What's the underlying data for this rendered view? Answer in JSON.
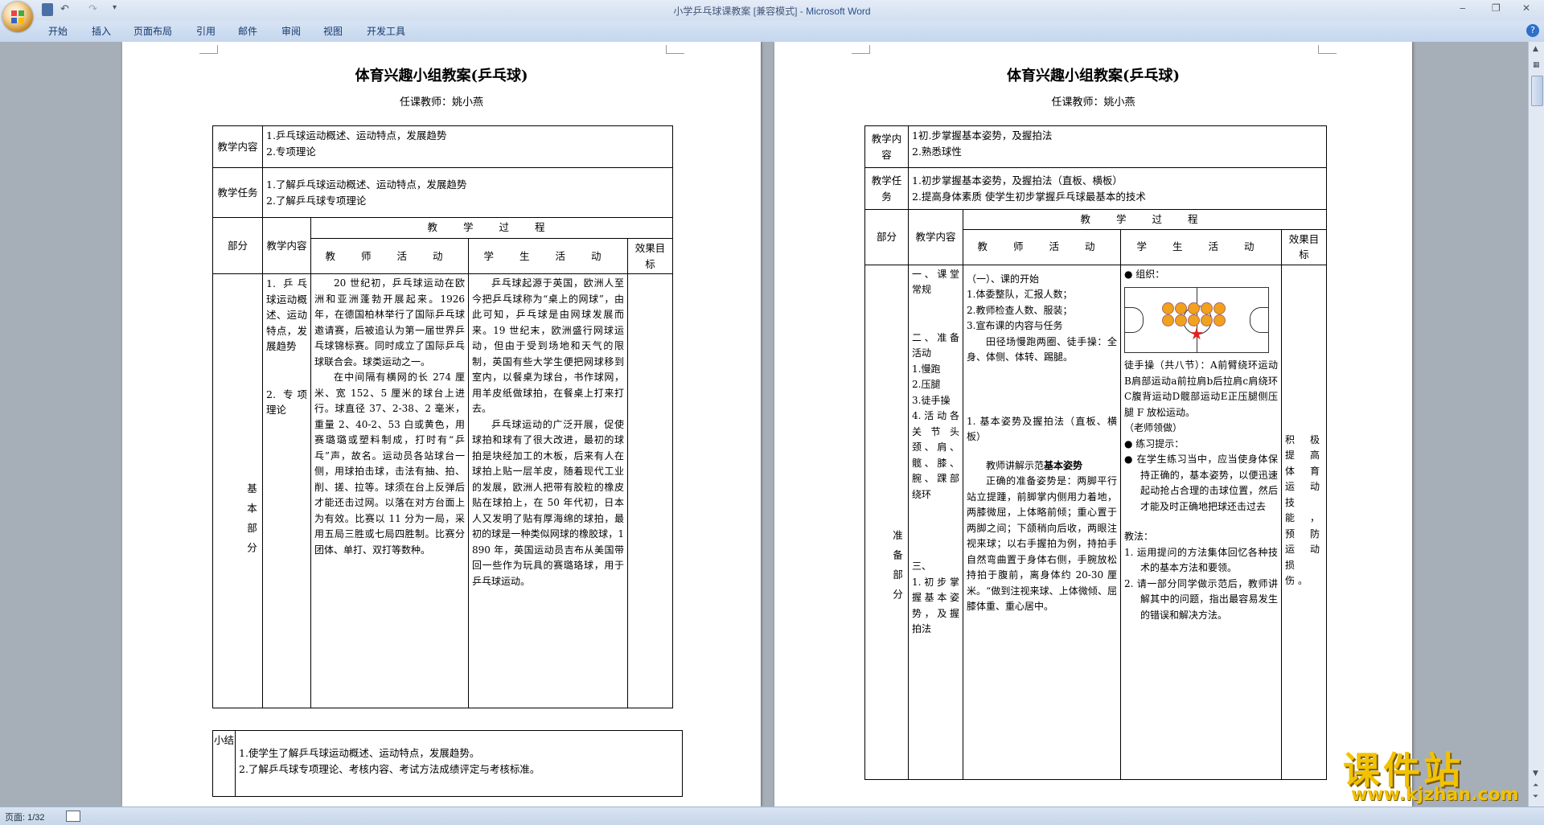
{
  "window": {
    "title": "小学乒乓球课教案 [兼容模式] - ",
    "app_name": "Microsoft Word"
  },
  "ribbon": {
    "tabs": [
      "开始",
      "插入",
      "页面布局",
      "引用",
      "邮件",
      "审阅",
      "视图",
      "开发工具"
    ]
  },
  "page1": {
    "title": "体育兴趣小组教案(乒乓球)",
    "teacher": "任课教师：姚小燕",
    "content_label": "教学内容",
    "content_lines": [
      "1.乒乓球运动概述、运动特点，发展趋势",
      "2.专项理论"
    ],
    "task_label": "教学任务",
    "task_lines": [
      "1.了解乒乓球运动概述、运动特点，发展趋势",
      "2.了解乒乓球专项理论"
    ],
    "header": {
      "part": "部分",
      "teach_content": "教学内容",
      "process": "教 学 过 程",
      "teacher_activity": "教 师 活 动",
      "student_activity": "学 生 活 动",
      "effect": "效果目标"
    },
    "part_name": "基本部分",
    "content_items": [
      "1. 乒乓球运动概述、运动特点，发展趋势",
      "2. 专项理论"
    ],
    "teacher_paragraphs": [
      "20 世纪初，乒乓球运动在欧洲和亚洲蓬勃开展起来。1926 年，在德国柏林举行了国际乒乓球邀请赛，后被追认为第一届世界乒乓球锦标赛。同时成立了国际乒乓球联合会。球类运动之一。",
      "在中间隔有横网的长 274 厘米、宽 152、5 厘米的球台上进行。球直径 37、2-38、2 毫米，重量 2、40-2、53 白或黄色，用赛璐璐或塑料制成，打时有“乒乓”声，故名。运动员各站球台一侧，用球拍击球，击法有抽、拍、削、搓、拉等。球须在台上反弹后才能还击过网。以落在对方台面上为有效。比赛以 11 分为一局，采用五局三胜或七局四胜制。比赛分团体、单打、双打等数种。"
    ],
    "student_paragraphs": [
      "乒乓球起源于英国，欧洲人至今把乒乓球称为“桌上的网球”，由此可知，乒乓球是由网球发展而来。19 世纪末，欧洲盛行网球运动，但由于受到场地和天气的限制，英国有些大学生便把网球移到室内，以餐桌为球台，书作球网，用羊皮纸做球拍，在餐桌上打来打去。",
      "乒乓球运动的广泛开展，促使球拍和球有了很大改进，最初的球拍是块经加工的木板，后来有人在球拍上贴一层羊皮，随着现代工业的发展，欧洲人把带有胶粒的橡皮贴在球拍上，在 50 年代初，日本人又发明了贴有厚海绵的球拍，最初的球是一种类似网球的橡胶球，1890 年，英国运动员吉布从美国带回一些作为玩具的赛璐珞球，用于乒乓球运动。"
    ],
    "summary_label": "小结",
    "summary_lines": [
      "1.使学生了解乒乓球运动概述、运动特点，发展趋势。",
      "2.了解乒乓球专项理论、考核内容、考试方法成绩评定与考核标准。"
    ]
  },
  "page2": {
    "title": "体育兴趣小组教案(乒乓球)",
    "teacher": "任课教师：姚小燕",
    "content_label": "教学内容",
    "content_lines": [
      "1初.步掌握基本姿势，及握拍法",
      "2.熟悉球性"
    ],
    "task_label": "教学任务",
    "task_lines": [
      "1.初步掌握基本姿势，及握拍法（直板、横板）",
      "2.提高身体素质 使学生初步掌握乒乓球最基本的技术"
    ],
    "header": {
      "part": "部分",
      "teach_content": "教学内容",
      "process": "教 学 过 程",
      "teacher_activity": "教 师 活 动",
      "student_activity": "学 生 活 动",
      "effect": "效果目标"
    },
    "part_name": "准备部分",
    "content_items": [
      "一、课堂常规",
      "二、准备活动",
      "1.慢跑",
      "2.压腿",
      "3.徒手操",
      "4.活动各关节头颈、肩、髋、膝、腕、踝部绕环",
      "三、",
      "1.初步掌握基本姿势，及握拍法"
    ],
    "teacher_lines": [
      "（一）、课的开始",
      "1.体委整队，汇报人数；",
      "2.教师检查人数、服装；",
      "3.宣布课的内容与任务",
      "田径场慢跑两圈、徒手操：全身、体侧、体转、踢腿。",
      "1. 基本姿势及握拍法（直板、横板）",
      "教师讲解示范",
      "基本姿势",
      "正确的准备姿势是：两脚平行站立提踵，前脚掌内侧用力着地，两膝微屈，上体略前倾；重心置于两脚之间；下颌稍向后收，两眼注视来球；以右手握拍为例，持拍手自然弯曲置于身体右侧，手腕放松持拍于腹前，离身体约 20-30 厘米。“做到注视来球、上体微倾、屈膝体重、重心居中。"
    ],
    "student_lines": [
      "组织：",
      "徒手操（共八节）：A前臂绕环运动B肩部运动a前拉肩b后拉肩c肩绕环C腹背运动D髋部运动E正压腿侧压腿 F 放松运动。",
      "（老师领做）",
      "练习提示：",
      "在学生练习当中，应当使身体保持正确的，基本姿势，以便迅速起动抢占合理的击球位置，然后才能及时正确地把球还击过去",
      "教法：",
      "1. 运用提问的方法集体回忆各种技术的基本方法和要领。",
      "2. 请一部分同学做示范后，教师讲解其中的问题，指出最容易发生的错误和解决方法。"
    ],
    "effect_text": "积极提高体育运动技能，预防运动损伤。"
  },
  "status": {
    "page": "页面: 1/32"
  },
  "watermark": {
    "text": "课件站",
    "url": "www.kjzhan.com"
  },
  "colors": {
    "accent": "#2a4f8a",
    "watermark": "#f2c200",
    "star": "#e02020",
    "ball": "#f1a21c"
  }
}
